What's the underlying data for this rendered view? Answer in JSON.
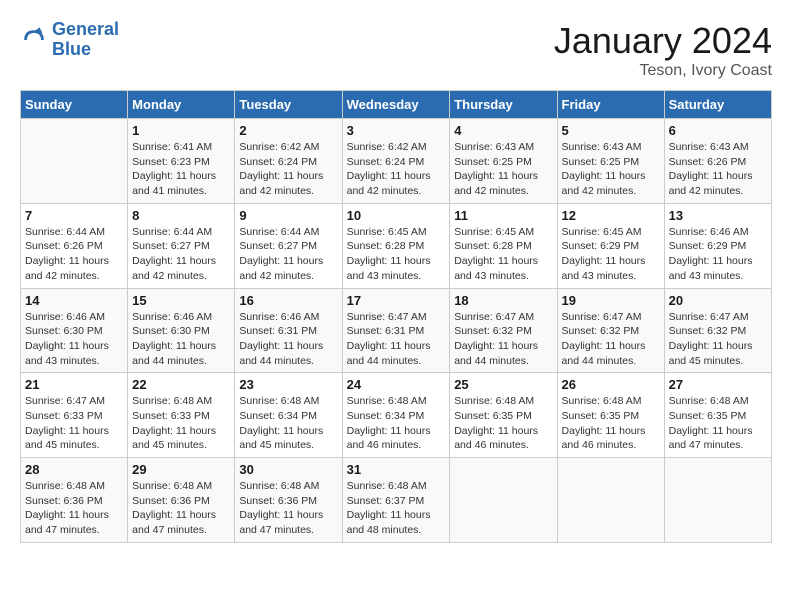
{
  "logo": {
    "line1": "General",
    "line2": "Blue"
  },
  "title": "January 2024",
  "subtitle": "Teson, Ivory Coast",
  "days": [
    "Sunday",
    "Monday",
    "Tuesday",
    "Wednesday",
    "Thursday",
    "Friday",
    "Saturday"
  ],
  "weeks": [
    [
      {
        "date": "",
        "info": ""
      },
      {
        "date": "1",
        "info": "Sunrise: 6:41 AM\nSunset: 6:23 PM\nDaylight: 11 hours\nand 41 minutes."
      },
      {
        "date": "2",
        "info": "Sunrise: 6:42 AM\nSunset: 6:24 PM\nDaylight: 11 hours\nand 42 minutes."
      },
      {
        "date": "3",
        "info": "Sunrise: 6:42 AM\nSunset: 6:24 PM\nDaylight: 11 hours\nand 42 minutes."
      },
      {
        "date": "4",
        "info": "Sunrise: 6:43 AM\nSunset: 6:25 PM\nDaylight: 11 hours\nand 42 minutes."
      },
      {
        "date": "5",
        "info": "Sunrise: 6:43 AM\nSunset: 6:25 PM\nDaylight: 11 hours\nand 42 minutes."
      },
      {
        "date": "6",
        "info": "Sunrise: 6:43 AM\nSunset: 6:26 PM\nDaylight: 11 hours\nand 42 minutes."
      }
    ],
    [
      {
        "date": "7",
        "info": "Sunrise: 6:44 AM\nSunset: 6:26 PM\nDaylight: 11 hours\nand 42 minutes."
      },
      {
        "date": "8",
        "info": "Sunrise: 6:44 AM\nSunset: 6:27 PM\nDaylight: 11 hours\nand 42 minutes."
      },
      {
        "date": "9",
        "info": "Sunrise: 6:44 AM\nSunset: 6:27 PM\nDaylight: 11 hours\nand 42 minutes."
      },
      {
        "date": "10",
        "info": "Sunrise: 6:45 AM\nSunset: 6:28 PM\nDaylight: 11 hours\nand 43 minutes."
      },
      {
        "date": "11",
        "info": "Sunrise: 6:45 AM\nSunset: 6:28 PM\nDaylight: 11 hours\nand 43 minutes."
      },
      {
        "date": "12",
        "info": "Sunrise: 6:45 AM\nSunset: 6:29 PM\nDaylight: 11 hours\nand 43 minutes."
      },
      {
        "date": "13",
        "info": "Sunrise: 6:46 AM\nSunset: 6:29 PM\nDaylight: 11 hours\nand 43 minutes."
      }
    ],
    [
      {
        "date": "14",
        "info": "Sunrise: 6:46 AM\nSunset: 6:30 PM\nDaylight: 11 hours\nand 43 minutes."
      },
      {
        "date": "15",
        "info": "Sunrise: 6:46 AM\nSunset: 6:30 PM\nDaylight: 11 hours\nand 44 minutes."
      },
      {
        "date": "16",
        "info": "Sunrise: 6:46 AM\nSunset: 6:31 PM\nDaylight: 11 hours\nand 44 minutes."
      },
      {
        "date": "17",
        "info": "Sunrise: 6:47 AM\nSunset: 6:31 PM\nDaylight: 11 hours\nand 44 minutes."
      },
      {
        "date": "18",
        "info": "Sunrise: 6:47 AM\nSunset: 6:32 PM\nDaylight: 11 hours\nand 44 minutes."
      },
      {
        "date": "19",
        "info": "Sunrise: 6:47 AM\nSunset: 6:32 PM\nDaylight: 11 hours\nand 44 minutes."
      },
      {
        "date": "20",
        "info": "Sunrise: 6:47 AM\nSunset: 6:32 PM\nDaylight: 11 hours\nand 45 minutes."
      }
    ],
    [
      {
        "date": "21",
        "info": "Sunrise: 6:47 AM\nSunset: 6:33 PM\nDaylight: 11 hours\nand 45 minutes."
      },
      {
        "date": "22",
        "info": "Sunrise: 6:48 AM\nSunset: 6:33 PM\nDaylight: 11 hours\nand 45 minutes."
      },
      {
        "date": "23",
        "info": "Sunrise: 6:48 AM\nSunset: 6:34 PM\nDaylight: 11 hours\nand 45 minutes."
      },
      {
        "date": "24",
        "info": "Sunrise: 6:48 AM\nSunset: 6:34 PM\nDaylight: 11 hours\nand 46 minutes."
      },
      {
        "date": "25",
        "info": "Sunrise: 6:48 AM\nSunset: 6:35 PM\nDaylight: 11 hours\nand 46 minutes."
      },
      {
        "date": "26",
        "info": "Sunrise: 6:48 AM\nSunset: 6:35 PM\nDaylight: 11 hours\nand 46 minutes."
      },
      {
        "date": "27",
        "info": "Sunrise: 6:48 AM\nSunset: 6:35 PM\nDaylight: 11 hours\nand 47 minutes."
      }
    ],
    [
      {
        "date": "28",
        "info": "Sunrise: 6:48 AM\nSunset: 6:36 PM\nDaylight: 11 hours\nand 47 minutes."
      },
      {
        "date": "29",
        "info": "Sunrise: 6:48 AM\nSunset: 6:36 PM\nDaylight: 11 hours\nand 47 minutes."
      },
      {
        "date": "30",
        "info": "Sunrise: 6:48 AM\nSunset: 6:36 PM\nDaylight: 11 hours\nand 47 minutes."
      },
      {
        "date": "31",
        "info": "Sunrise: 6:48 AM\nSunset: 6:37 PM\nDaylight: 11 hours\nand 48 minutes."
      },
      {
        "date": "",
        "info": ""
      },
      {
        "date": "",
        "info": ""
      },
      {
        "date": "",
        "info": ""
      }
    ]
  ]
}
